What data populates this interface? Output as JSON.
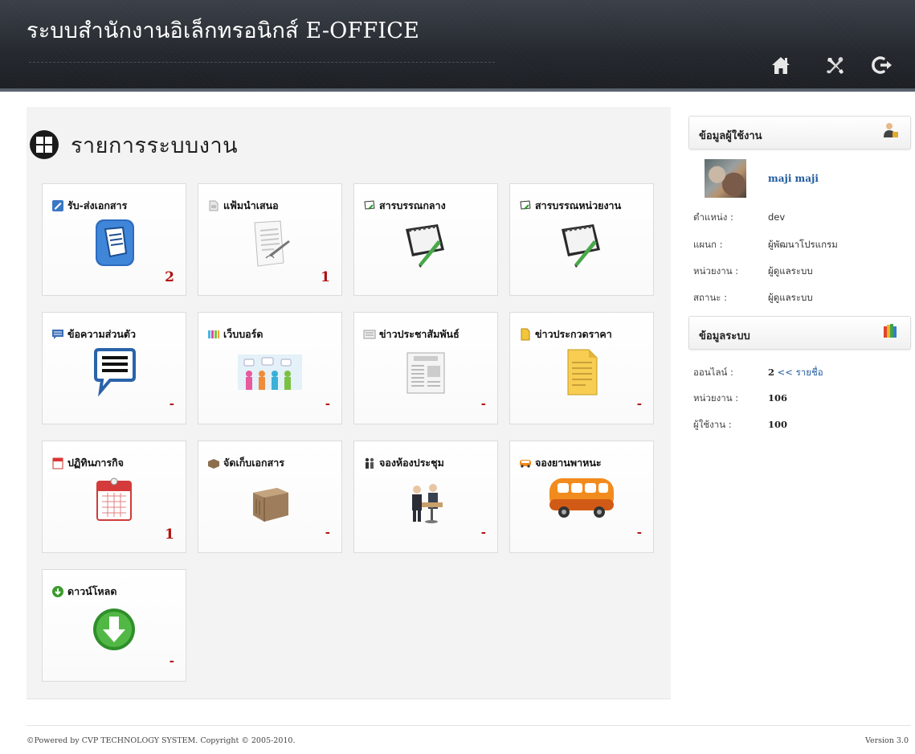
{
  "header": {
    "title": "ระบบสำนักงานอิเล็กทรอนิกส์ E-OFFICE",
    "icons": [
      "home-icon",
      "tools-icon",
      "logout-icon"
    ]
  },
  "main": {
    "page_title": "รายการระบบงาน",
    "tiles": [
      {
        "label": "รับ-ส่งเอกสาร",
        "count": "2",
        "icon": "document-app-icon"
      },
      {
        "label": "แฟ้มนำเสนอ",
        "count": "1",
        "icon": "file-presentation-icon"
      },
      {
        "label": "สารบรรณกลาง",
        "count": "",
        "icon": "planner-pen-icon"
      },
      {
        "label": "สารบรรณหน่วยงาน",
        "count": "",
        "icon": "planner-pen-icon"
      },
      {
        "label": "ข้อความส่วนตัว",
        "count": "-",
        "icon": "message-bubble-icon"
      },
      {
        "label": "เว็บบอร์ด",
        "count": "-",
        "icon": "webboard-people-icon"
      },
      {
        "label": "ข่าวประชาสัมพันธ์",
        "count": "-",
        "icon": "newspaper-icon"
      },
      {
        "label": "ข่าวประกวดราคา",
        "count": "-",
        "icon": "bid-document-icon"
      },
      {
        "label": "ปฏิทินภารกิจ",
        "count": "1",
        "icon": "calendar-icon"
      },
      {
        "label": "จัดเก็บเอกสาร",
        "count": "-",
        "icon": "archive-box-icon"
      },
      {
        "label": "จองห้องประชุม",
        "count": "-",
        "icon": "meeting-room-icon"
      },
      {
        "label": "จองยานพาหนะ",
        "count": "-",
        "icon": "bus-icon"
      },
      {
        "label": "ดาวน์โหลด",
        "count": "-",
        "icon": "download-icon"
      }
    ]
  },
  "sidebar": {
    "user_panel_title": "ข้อมูลผู้ใช้งาน",
    "user_name": "maji maji",
    "user_rows": [
      {
        "label": "ตำแหน่ง :",
        "value": "dev"
      },
      {
        "label": "แผนก :",
        "value": "ผู้พัฒนาโปรแกรม"
      },
      {
        "label": "หน่วยงาน :",
        "value": "ผู้ดูแลระบบ"
      },
      {
        "label": "สถานะ :",
        "value": "ผู้ดูแลระบบ"
      }
    ],
    "system_panel_title": "ข้อมูลระบบ",
    "system_rows": {
      "online_label": "ออนไลน์ :",
      "online_value": "2",
      "online_link": "<< รายชื่อ",
      "units_label": "หน่วยงาน :",
      "units_value": "106",
      "users_label": "ผู้ใช้งาน :",
      "users_value": "100"
    }
  },
  "footer": {
    "copyright": "©Powered by CVP TECHNOLOGY SYSTEM. Copyright © 2005-2010.",
    "version": "Version 3.0"
  },
  "colors": {
    "header_bg": "#23272d",
    "count_red": "#b20f0f",
    "link_blue": "#1f5a9e",
    "panel_bg": "#f3f3f3"
  }
}
